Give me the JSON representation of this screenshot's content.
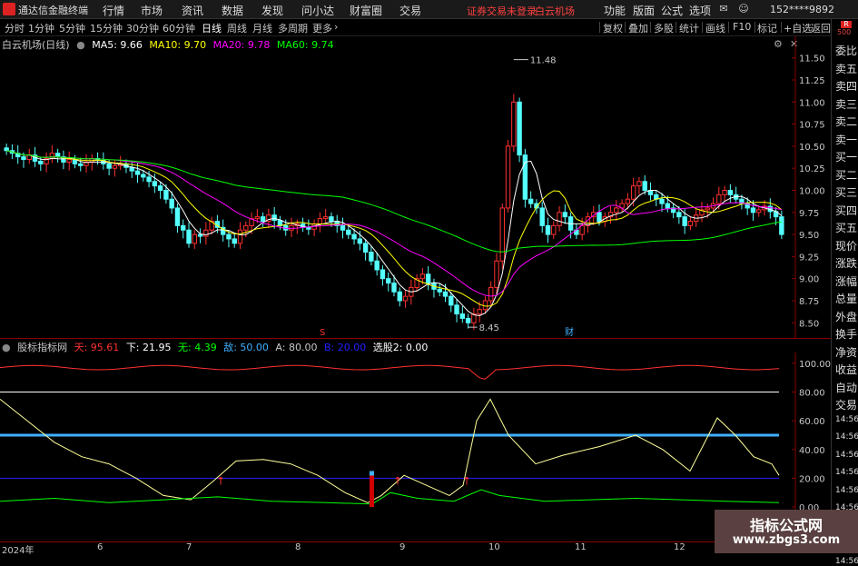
{
  "menubar": {
    "app_title": "通达信金融终端",
    "menus": [
      "行情",
      "市场",
      "资讯",
      "数据",
      "发现",
      "问小达",
      "财富圈",
      "交易"
    ],
    "alert": "证券交易未登录",
    "stock": "白云机场",
    "right_menus": [
      "功能",
      "版面",
      "公式",
      "选项"
    ],
    "account": "152****9892"
  },
  "periods": [
    "分时",
    "1分钟",
    "5分钟",
    "15分钟",
    "30分钟",
    "60分钟",
    "日线",
    "周线",
    "月线",
    "多周期",
    "更多"
  ],
  "active_period": "日线",
  "toolbar": [
    "复权",
    "叠加",
    "多股",
    "统计",
    "画线",
    "F10",
    "标记",
    "+自选",
    "返回"
  ],
  "chart_title": "白云机场(日线)",
  "ma_legend": {
    "ma5": "MA5: 9.66",
    "ma10": "MA10: 9.70",
    "ma20": "MA20: 9.78",
    "ma60": "MA60: 9.74"
  },
  "annotations": {
    "high": "11.48",
    "low": "8.45",
    "mark_s": "S",
    "mark_cai": "财"
  },
  "indicator_header": {
    "name": "股标指标网",
    "tian": "天: 95.61",
    "xia": "下: 21.95",
    "wu": "无: 4.39",
    "di": "敌: 50.00",
    "a": "A: 80.00",
    "b": "B: 20.00",
    "xuangu": "选股2: 0.00"
  },
  "right_panel": {
    "top_badge": "R",
    "top_code": "500",
    "items": [
      "委比",
      "卖五",
      "卖四",
      "卖三",
      "卖二",
      "卖一",
      "买一",
      "买二",
      "买三",
      "买四",
      "买五",
      "现价",
      "涨跌",
      "涨幅",
      "总量",
      "外盘",
      "换手",
      "净资",
      "收益",
      "自动",
      "交易",
      "14:56",
      "14:56",
      "14:56",
      "14:56",
      "14:56",
      "14:56",
      "14:56",
      "14:56",
      "14:56"
    ]
  },
  "x_axis_labels": [
    "2024年",
    "6",
    "7",
    "8",
    "9",
    "10",
    "11",
    "12"
  ],
  "watermark": {
    "line1": "指标公式网",
    "line2": "www.zbgs3.com"
  },
  "chart_data": [
    {
      "type": "candlestick",
      "title": "白云机场(日线)",
      "y_ticks": [
        11.5,
        11.25,
        11.0,
        10.75,
        10.5,
        10.25,
        10.0,
        9.75,
        9.5,
        9.25,
        9.0,
        8.75,
        8.5
      ],
      "ylim": [
        8.4,
        11.6
      ],
      "close": [
        10.45,
        10.42,
        10.38,
        10.35,
        10.4,
        10.33,
        10.3,
        10.36,
        10.42,
        10.38,
        10.32,
        10.35,
        10.3,
        10.28,
        10.32,
        10.36,
        10.34,
        10.3,
        10.25,
        10.28,
        10.3,
        10.26,
        10.22,
        10.18,
        10.15,
        10.1,
        10.05,
        10.0,
        9.9,
        9.8,
        9.6,
        9.55,
        9.4,
        9.5,
        9.48,
        9.55,
        9.65,
        9.58,
        9.5,
        9.45,
        9.4,
        9.55,
        9.6,
        9.68,
        9.7,
        9.65,
        9.72,
        9.66,
        9.6,
        9.55,
        9.6,
        9.62,
        9.58,
        9.56,
        9.62,
        9.68,
        9.7,
        9.65,
        9.6,
        9.55,
        9.5,
        9.45,
        9.4,
        9.3,
        9.2,
        9.1,
        9.0,
        8.95,
        8.85,
        8.75,
        8.8,
        8.9,
        9.0,
        9.05,
        8.95,
        8.88,
        8.85,
        8.8,
        8.7,
        8.6,
        8.55,
        8.5,
        8.6,
        8.65,
        8.75,
        8.9,
        9.2,
        9.8,
        10.5,
        11.0,
        10.4,
        9.9,
        9.85,
        9.8,
        9.6,
        9.5,
        9.6,
        9.75,
        9.7,
        9.55,
        9.5,
        9.6,
        9.7,
        9.75,
        9.65,
        9.7,
        9.75,
        9.8,
        9.85,
        9.9,
        10.05,
        10.1,
        10.0,
        9.95,
        9.9,
        9.85,
        9.8,
        9.75,
        9.7,
        9.6,
        9.65,
        9.72,
        9.78,
        9.8,
        9.85,
        9.95,
        10.0,
        9.95,
        9.9,
        9.85,
        9.8,
        9.75,
        9.78,
        9.82,
        9.76,
        9.7,
        9.5
      ],
      "ma_series": [
        {
          "name": "MA5",
          "color": "#ffffff",
          "value": 9.66
        },
        {
          "name": "MA10",
          "color": "#ffff00",
          "value": 9.7
        },
        {
          "name": "MA20",
          "color": "#ff00ff",
          "value": 9.78
        },
        {
          "name": "MA60",
          "color": "#00ff00",
          "value": 9.74
        }
      ]
    },
    {
      "type": "line",
      "title": "股标指标网",
      "y_ticks": [
        100.0,
        80.0,
        60.0,
        40.0,
        20.0,
        0.0
      ],
      "ylim": [
        0,
        105
      ],
      "hlines": [
        {
          "value": 80,
          "color": "#ffffff"
        },
        {
          "value": 50,
          "color": "#3fb0ff"
        },
        {
          "value": 20,
          "color": "#2020ff"
        }
      ]
    }
  ]
}
